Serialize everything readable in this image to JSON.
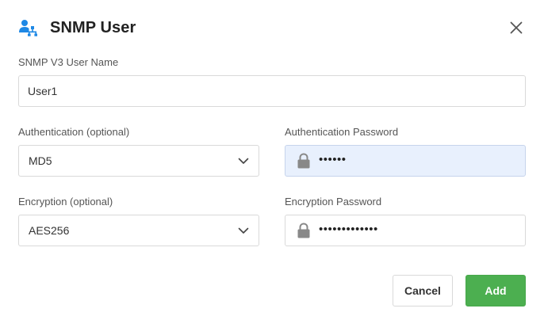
{
  "dialog": {
    "title": "SNMP User",
    "title_icon": "user-network-icon",
    "close_icon": "close-icon"
  },
  "form": {
    "username": {
      "label": "SNMP V3 User Name",
      "value": "User1"
    },
    "authentication": {
      "label": "Authentication (optional)",
      "value": "MD5"
    },
    "authentication_password": {
      "label": "Authentication Password",
      "masked_value": "••••••"
    },
    "encryption": {
      "label": "Encryption (optional)",
      "value": "AES256"
    },
    "encryption_password": {
      "label": "Encryption Password",
      "masked_value": "•••••••••••••"
    }
  },
  "buttons": {
    "cancel_label": "Cancel",
    "add_label": "Add"
  },
  "colors": {
    "accent_blue": "#1e88e5",
    "add_green": "#4caf50",
    "active_field_bg": "#e8f0fd"
  }
}
